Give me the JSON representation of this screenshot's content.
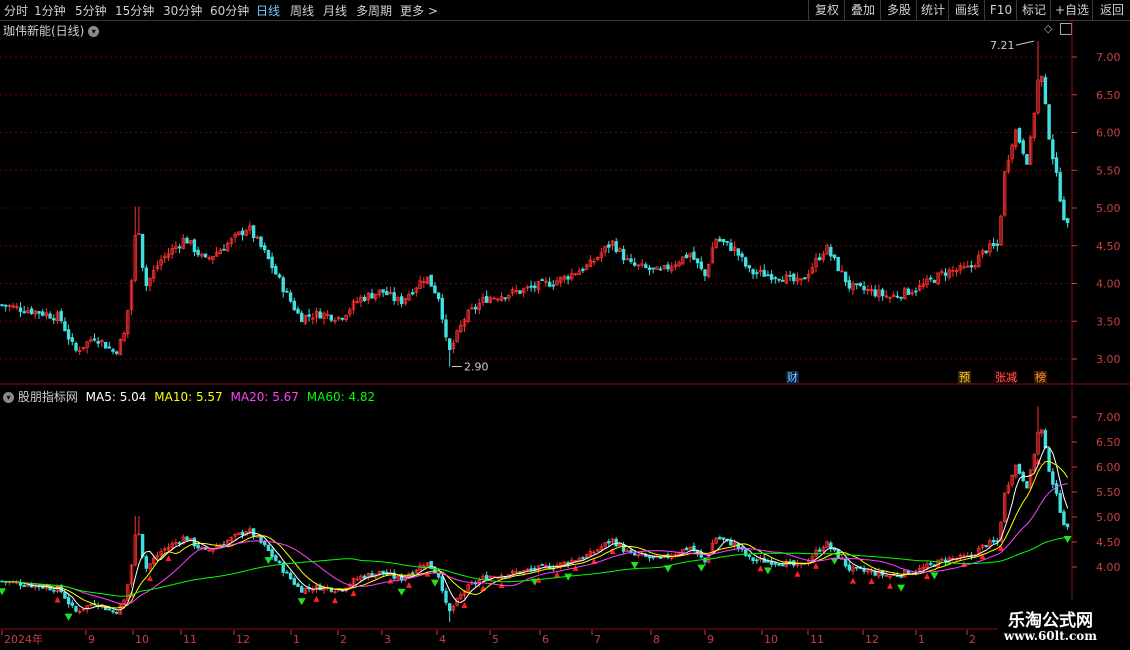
{
  "toolbar": {
    "periods": [
      "分时",
      "1分钟",
      "5分钟",
      "15分钟",
      "30分钟",
      "60分钟",
      "日线",
      "周线",
      "月线",
      "多周期",
      "更多 >"
    ],
    "active_period": "日线",
    "right_buttons": [
      "复权",
      "叠加",
      "多股",
      "统计",
      "画线",
      "F10",
      "标记",
      "+自选",
      "返回"
    ]
  },
  "main_panel": {
    "title": "珈伟新能(日线)",
    "high_label": "7.21",
    "low_label": "2.90",
    "y_ticks": [
      "7.00",
      "6.50",
      "6.00",
      "5.50",
      "5.00",
      "4.50",
      "4.00",
      "3.50",
      "3.00"
    ],
    "markers": {
      "cai": "财",
      "yu": "预",
      "zhangjian": "张减",
      "bang": "榜"
    }
  },
  "indicator_panel": {
    "name": "股朋指标网",
    "ma5": "MA5: 5.04",
    "ma10": "MA10: 5.57",
    "ma20": "MA20: 5.67",
    "ma60": "MA60: 4.82",
    "y_ticks": [
      "7.00",
      "6.50",
      "6.00",
      "5.50",
      "5.00",
      "4.50",
      "4.00"
    ]
  },
  "x_axis": {
    "labels": [
      "2024年",
      "9",
      "10",
      "11",
      "12",
      "1",
      "2",
      "3",
      "4",
      "5",
      "6",
      "7",
      "8",
      "9",
      "10",
      "11",
      "12",
      "1",
      "2"
    ]
  },
  "watermark": {
    "line1": "乐淘公式网",
    "line2": "www.60lt.com"
  },
  "colors": {
    "up": "#ff3030",
    "down": "#40e0e0",
    "grid": "#6b0000",
    "ma5": "#ffffff",
    "ma10": "#ffff00",
    "ma20": "#ff40ff",
    "ma60": "#00ff00"
  }
}
